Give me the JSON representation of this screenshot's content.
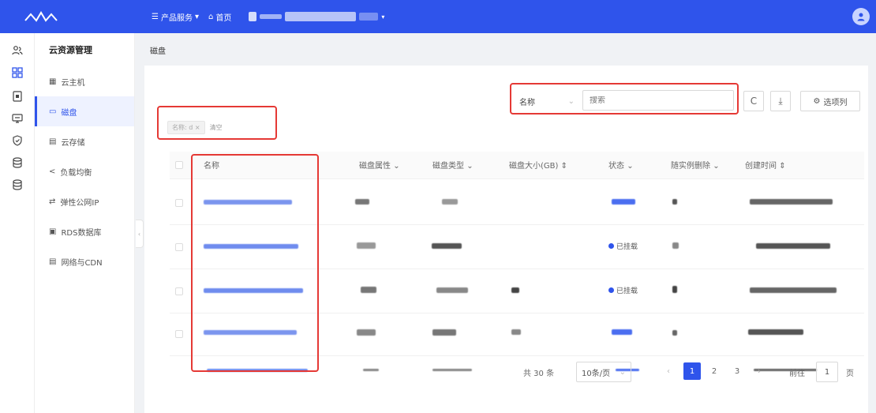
{
  "topbar": {
    "brand": "",
    "brand_sub": "",
    "product_menu": "产品服务",
    "home": "首页"
  },
  "sidebar": {
    "title": "云资源管理",
    "items": [
      {
        "label": "云主机",
        "icon": "server-icon"
      },
      {
        "label": "磁盘",
        "icon": "disk-icon"
      },
      {
        "label": "云存储",
        "icon": "storage-icon"
      },
      {
        "label": "负载均衡",
        "icon": "share-icon"
      },
      {
        "label": "弹性公网IP",
        "icon": "swap-icon"
      },
      {
        "label": "RDS数据库",
        "icon": "database-icon"
      },
      {
        "label": "网络与CDN",
        "icon": "network-icon"
      }
    ]
  },
  "breadcrumb": "磁盘",
  "toolbar": {
    "filter_field": "名称",
    "search_placeholder": "搜索",
    "refresh_icon": "C",
    "download_icon": "⤓",
    "columns_label": "选项列"
  },
  "filter_tags": {
    "tag": "名称: d",
    "clear": "清空"
  },
  "table": {
    "columns": [
      "名称",
      "磁盘属性",
      "磁盘类型",
      "磁盘大小(GB)",
      "状态",
      "随实例删除",
      "创建时间"
    ],
    "status_texts": [
      "",
      "已挂载",
      "已挂载",
      "",
      ""
    ]
  },
  "pagination": {
    "total": "共 30 条",
    "page_size": "10条/页",
    "pages": [
      "1",
      "2",
      "3"
    ],
    "current": "1",
    "goto_label": "前往",
    "goto_value": "1",
    "page_suffix": "页"
  },
  "colors": {
    "accent": "#2f54eb",
    "highlight": "#e53935"
  }
}
